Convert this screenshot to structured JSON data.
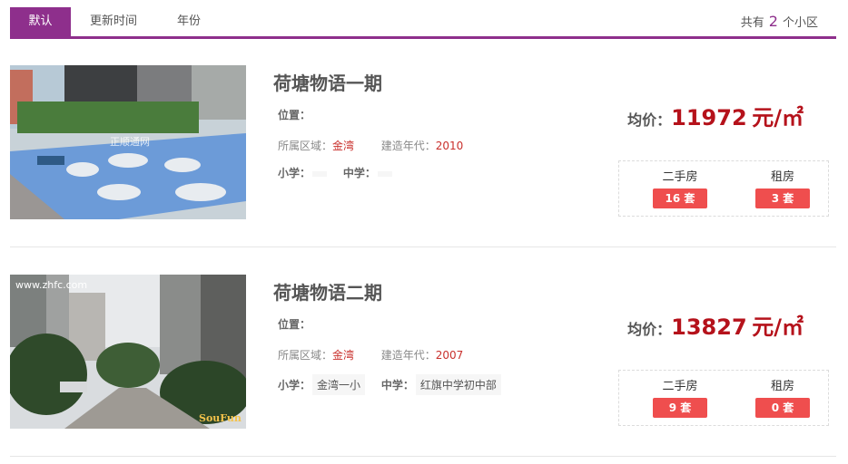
{
  "tabs": [
    {
      "label": "默认"
    },
    {
      "label": "更新时间"
    },
    {
      "label": "年份"
    }
  ],
  "summary": {
    "prefix": "共有",
    "count": "2",
    "suffix": "个小区"
  },
  "listings": [
    {
      "name": "荷塘物语一期",
      "location_label": "位置：",
      "location_value": "",
      "district_label": "所属区域：",
      "district": "金湾",
      "year_label": "建造年代：",
      "year": "2010",
      "primary_label": "小学：",
      "primary_school": "",
      "middle_label": "中学：",
      "middle_school": "",
      "price_label": "均价：",
      "price": "11972",
      "price_unit": "元/㎡",
      "resale_label": "二手房",
      "resale_count": "16 套",
      "rent_label": "租房",
      "rent_count": "3 套",
      "image_watermark": "正顺通网"
    },
    {
      "name": "荷塘物语二期",
      "location_label": "位置：",
      "location_value": "",
      "district_label": "所属区域：",
      "district": "金湾",
      "year_label": "建造年代：",
      "year": "2007",
      "primary_label": "小学：",
      "primary_school": "金湾一小",
      "middle_label": "中学：",
      "middle_school": "红旗中学初中部",
      "price_label": "均价：",
      "price": "13827",
      "price_unit": "元/㎡",
      "resale_label": "二手房",
      "resale_count": "9 套",
      "rent_label": "租房",
      "rent_count": "0 套",
      "image_watermark": "www.zhfc.com",
      "image_logo": "SouFun"
    }
  ],
  "colors": {
    "accent": "#8e2f8c",
    "price": "#b5121b",
    "button": "#ef4e4e",
    "district": "#c9302c"
  }
}
